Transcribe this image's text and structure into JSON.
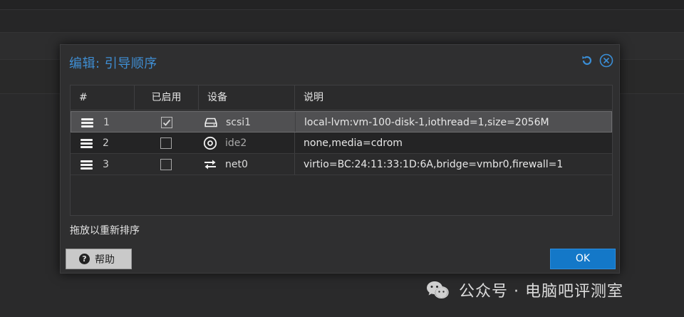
{
  "dialog": {
    "title": "编辑: 引导顺序",
    "hint": "拖放以重新排序",
    "help_label": "帮助",
    "ok_label": "OK"
  },
  "grid": {
    "columns": {
      "num": "#",
      "enabled": "已启用",
      "device": "设备",
      "description": "说明"
    },
    "rows": [
      {
        "num": "1",
        "enabled": true,
        "device": "scsi1",
        "device_icon": "hdd-icon",
        "description": "local-lvm:vm-100-disk-1,iothread=1,size=2056M",
        "selected": true
      },
      {
        "num": "2",
        "enabled": false,
        "device": "ide2",
        "device_icon": "cdrom-icon",
        "description": "none,media=cdrom",
        "selected": false
      },
      {
        "num": "3",
        "enabled": false,
        "device": "net0",
        "device_icon": "network-exchange-icon",
        "description": "virtio=BC:24:11:33:1D:6A,bridge=vmbr0,firewall=1",
        "selected": false
      }
    ]
  },
  "watermark": {
    "text": "公众号 · 电脑吧评测室"
  },
  "colors": {
    "accent": "#3f8ed3",
    "ok_button": "#1478c8",
    "selected_row": "#505052"
  }
}
